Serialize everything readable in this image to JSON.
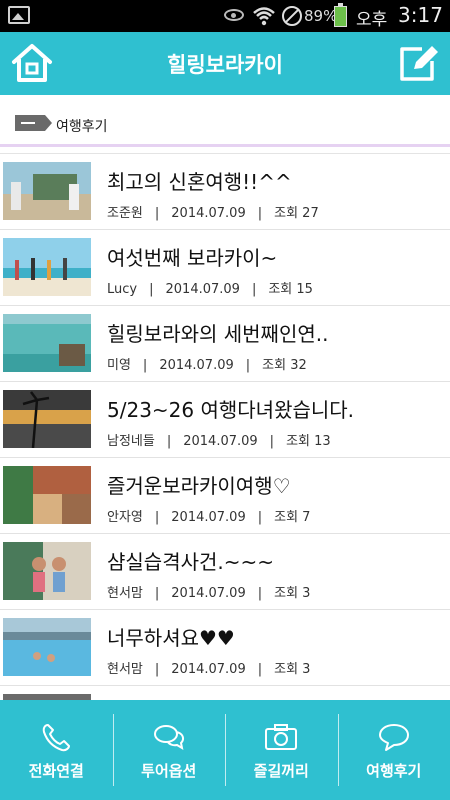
{
  "status_bar": {
    "battery_percent": "89%",
    "ampm": "오후",
    "time": "3:17",
    "battery_color": "#6cc04a"
  },
  "header": {
    "title": "힐링보라카이",
    "home_icon": "home-icon",
    "edit_icon": "edit-icon",
    "color": "#2fc0d0"
  },
  "section": {
    "label": "여행후기",
    "icon": "flag-icon"
  },
  "posts": [
    {
      "title": "최고의 신혼여행!!^^",
      "author": "조준원",
      "date": "2014.07.09",
      "views_label": "조회",
      "views": "27"
    },
    {
      "title": "여섯번째 보라카이~",
      "author": "Lucy",
      "date": "2014.07.09",
      "views_label": "조회",
      "views": "15"
    },
    {
      "title": "힐링보라와의 세번째인연..",
      "author": "미영",
      "date": "2014.07.09",
      "views_label": "조회",
      "views": "32"
    },
    {
      "title": "5/23~26 여행다녀왔습니다.",
      "author": "남정네들",
      "date": "2014.07.09",
      "views_label": "조회",
      "views": "13"
    },
    {
      "title": "즐거운보라카이여행♡",
      "author": "안자영",
      "date": "2014.07.09",
      "views_label": "조회",
      "views": "7"
    },
    {
      "title": "샴실습격사건.~~~",
      "author": "현서맘",
      "date": "2014.07.09",
      "views_label": "조회",
      "views": "3"
    },
    {
      "title": "너무하셔요♥♥",
      "author": "현서맘",
      "date": "2014.07.09",
      "views_label": "조회",
      "views": "3"
    }
  ],
  "separator": "|",
  "bottom_nav": [
    {
      "label": "전화연결",
      "icon": "phone-icon"
    },
    {
      "label": "투어옵션",
      "icon": "chat-bubbles-icon"
    },
    {
      "label": "즐길꺼리",
      "icon": "camera-icon"
    },
    {
      "label": "여행후기",
      "icon": "speech-bubble-icon"
    }
  ]
}
